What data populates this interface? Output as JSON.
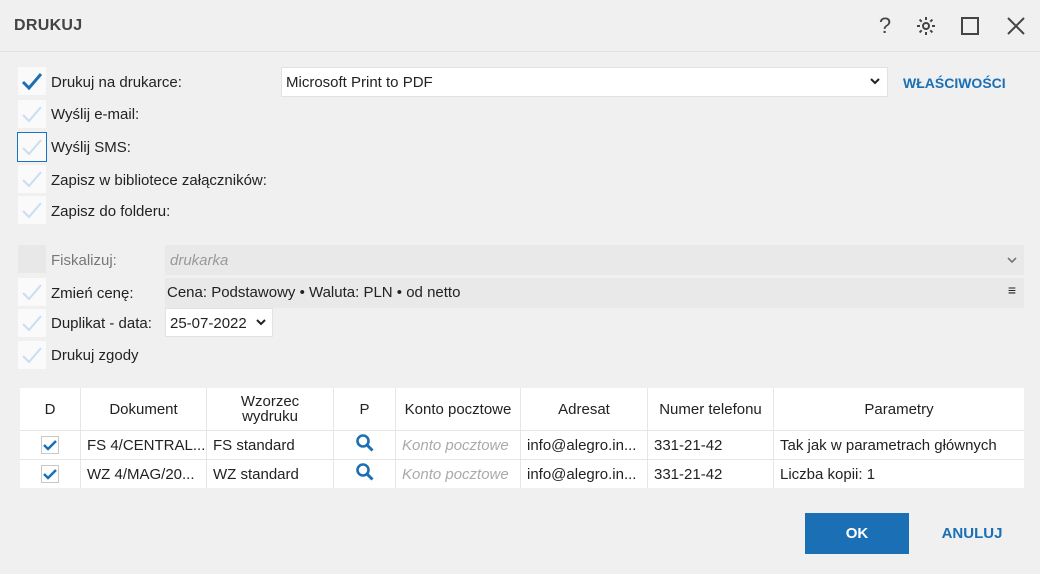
{
  "window": {
    "title": "DRUKUJ",
    "buttons": [
      "help-icon",
      "gear-icon",
      "maximize-icon",
      "close-icon"
    ],
    "help_label": "?"
  },
  "options": [
    {
      "label": "Drukuj na drukarce:",
      "checked": true
    },
    {
      "label": "Wyślij e-mail:",
      "checked": false
    },
    {
      "label": "Wyślij SMS:",
      "checked": false
    },
    {
      "label": "Zapisz w bibliotece załączników:",
      "checked": false
    },
    {
      "label": "Zapisz do folderu:",
      "checked": false
    }
  ],
  "printer": {
    "value": "Microsoft Print to PDF",
    "properties_label": "WŁAŚCIWOŚCI"
  },
  "fiscal": {
    "label": "Fiskalizuj:",
    "placeholder": "drukarka"
  },
  "price": {
    "label": "Zmień cenę:",
    "value": "Cena: Podstawowy • Waluta: PLN • od netto",
    "menu_glyph": "≡"
  },
  "duplicate": {
    "label": "Duplikat - data:",
    "value": "25-07-2022"
  },
  "consent": {
    "label": "Drukuj zgody"
  },
  "table": {
    "headers": [
      "D",
      "Dokument",
      "Wzorzec wydruku",
      "P",
      "Konto pocztowe",
      "Adresat",
      "Numer telefonu",
      "Parametry"
    ],
    "rows": [
      {
        "checked": true,
        "document": "FS 4/CENTRAL...",
        "template": "FS standard",
        "account": "Konto pocztowe",
        "recipient": "info@alegro.in...",
        "phone": "331-21-42",
        "params": "Tak jak w parametrach głównych"
      },
      {
        "checked": true,
        "document": "WZ 4/MAG/20...",
        "template": "WZ standard",
        "account": "Konto pocztowe",
        "recipient": "info@alegro.in...",
        "phone": "331-21-42",
        "params": "Liczba kopii: 1"
      }
    ]
  },
  "actions": {
    "ok_label": "OK",
    "cancel_label": "ANULUJ"
  },
  "colors": {
    "accent": "#1a6fb5",
    "check_active": "#1a6fb5",
    "check_inactive": "#c9def0",
    "background": "#f0f0f0"
  }
}
